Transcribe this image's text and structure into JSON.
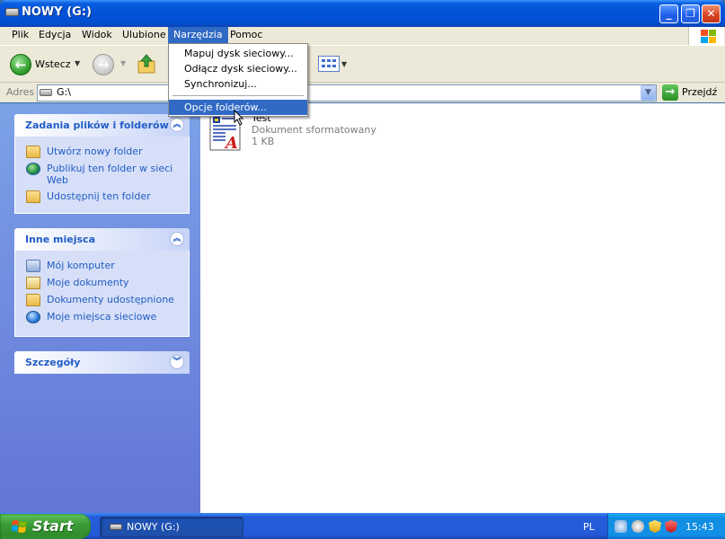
{
  "window": {
    "title": "NOWY (G:)",
    "buttons": {
      "minimize": "_",
      "maximize": "❐",
      "close": "✕"
    }
  },
  "menubar": {
    "items": [
      {
        "label": "Plik"
      },
      {
        "label": "Edycja"
      },
      {
        "label": "Widok"
      },
      {
        "label": "Ulubione"
      },
      {
        "label": "Narzędzia",
        "active": true
      },
      {
        "label": "Pomoc"
      }
    ]
  },
  "toolbar": {
    "back_label": "Wstecz"
  },
  "dropdown": {
    "items": [
      {
        "label": "Mapuj dysk sieciowy..."
      },
      {
        "label": "Odłącz dysk sieciowy..."
      },
      {
        "label": "Synchronizuj..."
      },
      {
        "label": "Opcje folderów...",
        "highlighted": true
      }
    ]
  },
  "address": {
    "label": "Adres",
    "value": "G:\\",
    "go_label": "Przejdź"
  },
  "taskpane": {
    "file_tasks": {
      "title": "Zadania plików i folderów",
      "items": [
        {
          "label": "Utwórz nowy folder",
          "icon": "new-folder-icon"
        },
        {
          "label": "Publikuj ten folder w sieci Web",
          "icon": "publish-web-icon"
        },
        {
          "label": "Udostępnij ten folder",
          "icon": "share-folder-icon"
        }
      ]
    },
    "other_places": {
      "title": "Inne miejsca",
      "items": [
        {
          "label": "Mój komputer",
          "icon": "my-computer-icon"
        },
        {
          "label": "Moje dokumenty",
          "icon": "my-documents-icon"
        },
        {
          "label": "Dokumenty udostępnione",
          "icon": "shared-documents-icon"
        },
        {
          "label": "Moje miejsca sieciowe",
          "icon": "network-places-icon"
        }
      ]
    },
    "details": {
      "title": "Szczegóły"
    }
  },
  "files": [
    {
      "name": "Test",
      "type": "Dokument sformatowany",
      "size": "1 KB",
      "icon": "rtf-document-icon"
    }
  ],
  "taskbar": {
    "start_label": "Start",
    "task_label": "NOWY (G:)",
    "language": "PL",
    "clock": "15:43"
  },
  "colors": {
    "title_blue": "#0453d8",
    "menu_highlight": "#316ac5",
    "taskpane_link": "#215dc6",
    "start_green": "#3b9e37"
  }
}
